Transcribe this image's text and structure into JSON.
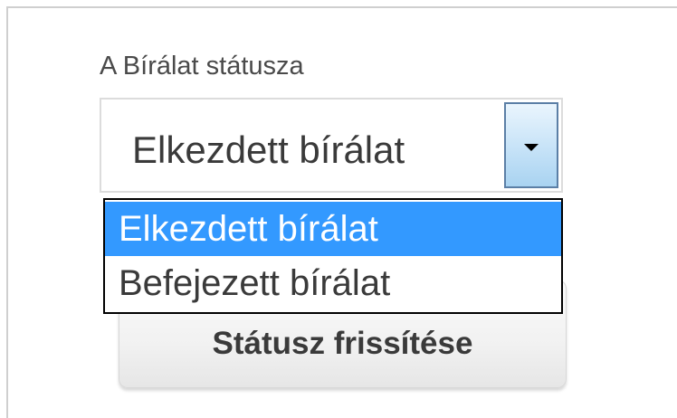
{
  "form": {
    "status_label": "A Bírálat státusza",
    "status_select": {
      "selected_value": "Elkezdett bírálat",
      "options": [
        {
          "label": "Elkezdett bírálat",
          "highlighted": true
        },
        {
          "label": "Befejezett bírálat",
          "highlighted": false
        }
      ],
      "arrow_icon": "dropdown-arrow-icon"
    },
    "update_button_label": "Státusz frissítése"
  },
  "colors": {
    "highlight": "#3399ff",
    "highlight_text": "#ffffff",
    "text": "#3a3a3a",
    "arrow_button": "#c9e4f8"
  }
}
